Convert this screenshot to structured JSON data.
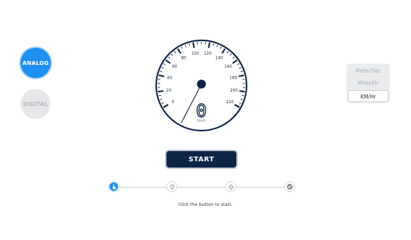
{
  "modes": {
    "analog_label": "ANALOG",
    "digital_label": "DIGITAL",
    "selected": "analog"
  },
  "gauge": {
    "min": 0,
    "max": 220,
    "major_step": 20,
    "tick_labels": [
      "0",
      "20",
      "40",
      "60",
      "80",
      "100",
      "120",
      "140",
      "160",
      "180",
      "200",
      "220"
    ],
    "current_speed": "0",
    "unit_label": "km/h"
  },
  "units": {
    "options": [
      "Meter/Sec",
      "Miles/Hr",
      "KM/Hr"
    ],
    "selected": "KM/Hr"
  },
  "start_button": {
    "label": "START"
  },
  "steps": [
    {
      "icon": "hand-pointer-icon",
      "status": "active"
    },
    {
      "icon": "location-pin-icon",
      "status": "pending"
    },
    {
      "icon": "crosshair-icon",
      "status": "pending"
    },
    {
      "icon": "check-circle-icon",
      "status": "pending"
    }
  ],
  "hint_text": "Click the button to start.",
  "colors": {
    "accent": "#1e8ef0",
    "dark": "#0d2545",
    "inactive": "#e6e8ea"
  }
}
